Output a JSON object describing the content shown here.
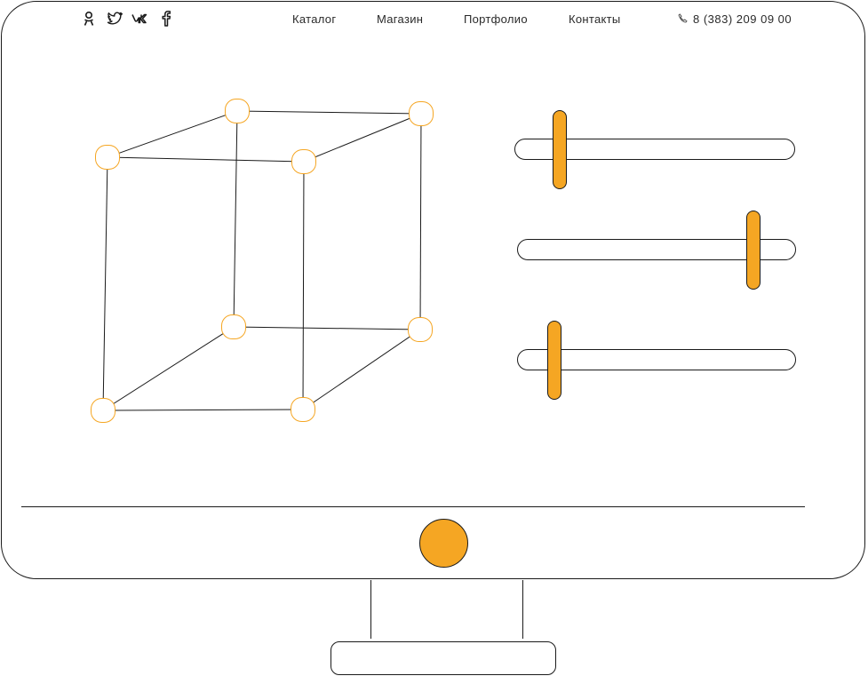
{
  "header": {
    "social": [
      {
        "name": "odnoklassniki-icon"
      },
      {
        "name": "twitter-icon"
      },
      {
        "name": "vk-icon"
      },
      {
        "name": "facebook-icon"
      }
    ],
    "nav": [
      {
        "label": "Каталог"
      },
      {
        "label": "Магазин"
      },
      {
        "label": "Портфолио"
      },
      {
        "label": "Контакты"
      }
    ],
    "phone": {
      "icon": "phone-icon",
      "number": "8 (383) 209 09 00"
    }
  },
  "sliders": [
    {
      "value": 0.16
    },
    {
      "value": 0.85
    },
    {
      "value": 0.13
    }
  ],
  "colors": {
    "accent": "#f5a623",
    "stroke": "#1a1a1a",
    "background": "#ffffff"
  }
}
